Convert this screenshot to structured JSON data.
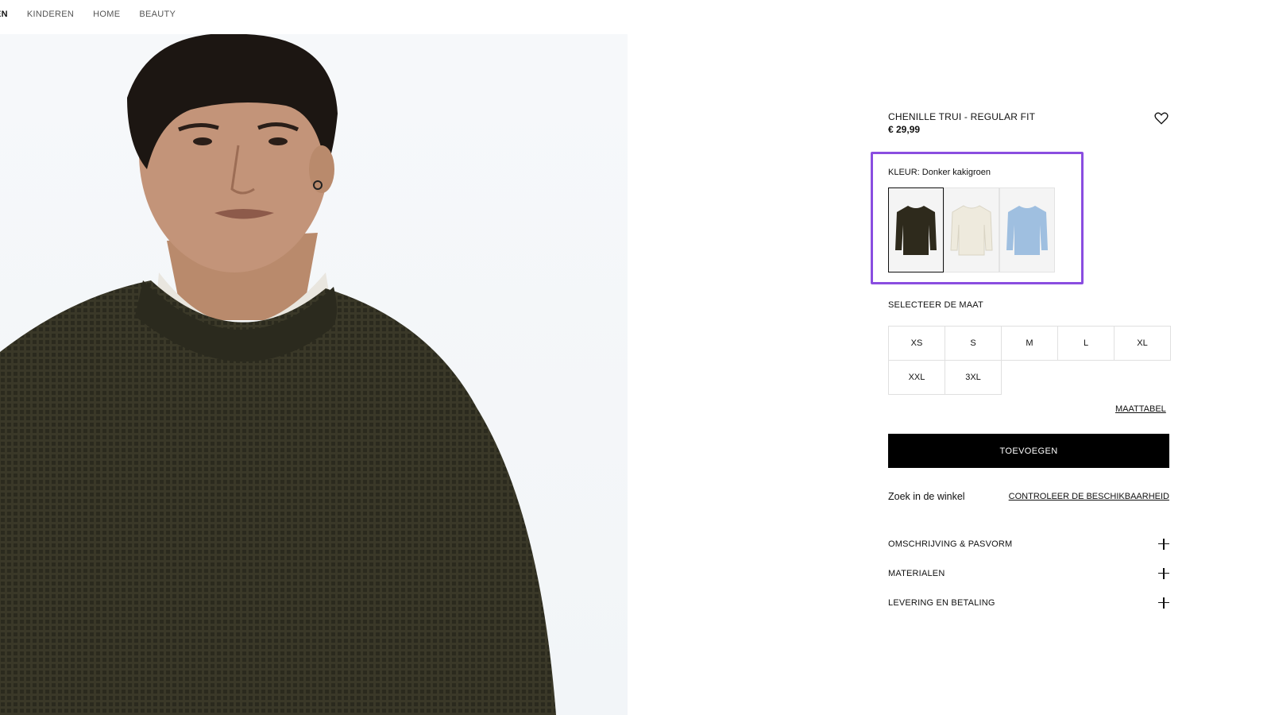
{
  "nav": {
    "items": [
      {
        "label": "EN",
        "active": true
      },
      {
        "label": "KINDEREN",
        "active": false
      },
      {
        "label": "HOME",
        "active": false
      },
      {
        "label": "BEAUTY",
        "active": false
      }
    ]
  },
  "product": {
    "title": "CHENILLE TRUI - REGULAR FIT",
    "price": "€ 29,99",
    "wishlist_icon": "heart-icon"
  },
  "color": {
    "label": "KLEUR: Donker kakigroen",
    "swatches": [
      {
        "name": "Donker kakigroen",
        "hex": "#2e2a1c",
        "selected": true
      },
      {
        "name": "Crème",
        "hex": "#eeeadd",
        "selected": false
      },
      {
        "name": "Lichtblauw",
        "hex": "#9fbfe0",
        "selected": false
      }
    ],
    "highlight_color": "#8a4de0"
  },
  "size": {
    "label": "SELECTEER DE MAAT",
    "options": [
      "XS",
      "S",
      "M",
      "L",
      "XL",
      "XXL",
      "3XL"
    ],
    "chart_link": "MAATTABEL"
  },
  "add_button": "TOEVOEGEN",
  "store": {
    "label": "Zoek in de winkel",
    "link": "CONTROLEER DE BESCHIKBAARHEID"
  },
  "accordion": [
    {
      "label": "OMSCHRIJVING & PASVORM",
      "icon": "plus-icon"
    },
    {
      "label": "MATERIALEN",
      "icon": "plus-icon"
    },
    {
      "label": "LEVERING EN BETALING",
      "icon": "plus-icon"
    }
  ],
  "colors": {
    "button_bg": "#000000",
    "sweater": "#3a3828"
  }
}
